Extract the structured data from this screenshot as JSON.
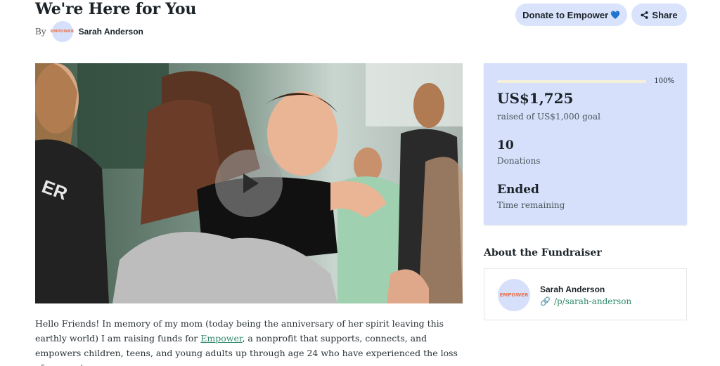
{
  "page": {
    "title": "We're Here for You",
    "by_label": "By",
    "author": "Sarah Anderson",
    "avatar_text": "EMPOWER"
  },
  "actions": {
    "donate_label": "Donate to Empower",
    "donate_emoji": "💙",
    "share_label": "Share"
  },
  "video": {
    "shirt_text": "ER"
  },
  "description": {
    "text_before": "Hello Friends! In memory of my mom (today being the anniversary of her spirit leaving this earthly world) I am raising funds for ",
    "link_text": "Empower",
    "text_after": ", a nonprofit that supports, connects, and empowers children, teens, and young adults up through age 24 who have experienced the loss of a parent."
  },
  "stats": {
    "progress_percent": 100,
    "progress_label": "100%",
    "raised_amount": "US$1,725",
    "goal_text": "raised of US$1,000 goal",
    "donations_count": "10",
    "donations_label": "Donations",
    "time_value": "Ended",
    "time_label": "Time remaining"
  },
  "about": {
    "heading": "About the Fundraiser",
    "avatar_text": "EMPOWER",
    "name": "Sarah Anderson",
    "profile_link": "/p/sarah-anderson"
  },
  "colors": {
    "accent_blue": "#d6e0fb",
    "link_green": "#2e8a6a",
    "brand_orange": "#e8704a"
  }
}
